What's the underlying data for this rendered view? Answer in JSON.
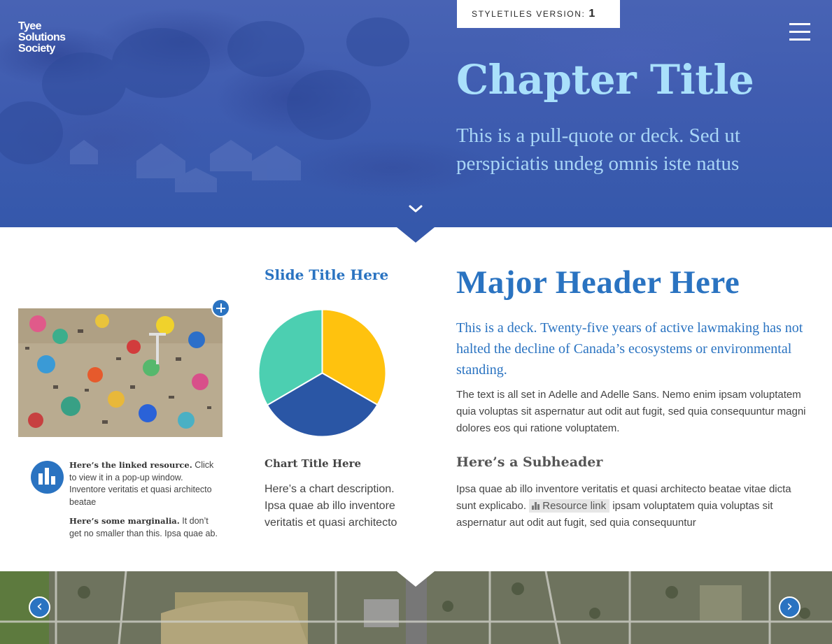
{
  "header": {
    "logo_lines": [
      "Tyee",
      "Solutions",
      "Society"
    ],
    "version_label": "STYLETILES VERSION: ",
    "version_number": "1",
    "chapter_title": "Chapter Title",
    "chapter_deck": "This is a pull-quote or deck. Sed ut perspiciatis undeg omnis iste natus",
    "icons": {
      "menu": "hamburger-menu-icon",
      "scroll": "chevron-down-icon"
    }
  },
  "left_column": {
    "marginalia": [
      {
        "bold": "Here’s the linked resource.",
        "text": " Click to view it in a pop-up window. Inventore veritatis et quasi architecto beatae"
      },
      {
        "bold": "Here’s some marginalia.",
        "text": " It don’t get no smaller than this. Ipsa quae ab."
      }
    ]
  },
  "middle_column": {
    "slide_title": "Slide Title Here",
    "chart_title": "Chart Title Here",
    "chart_description": "Here’s a chart description. Ipsa quae ab illo inventore veritatis et quasi architecto"
  },
  "chart_data": {
    "type": "pie",
    "title": "",
    "slices": [
      {
        "value": 33.3,
        "color": "#ffc20e"
      },
      {
        "value": 33.3,
        "color": "#2a56a5"
      },
      {
        "value": 33.4,
        "color": "#4ccfb1"
      }
    ]
  },
  "right_column": {
    "major_header": "Major Header Here",
    "deck": "This is a deck. Twenty-five years of active lawmaking has not halted the decline of Canada’s ecosystems or environmental standing.",
    "body": "The text is all set in Adelle and Adelle Sans. Nemo enim ipsam voluptatem quia voluptas sit aspernatur aut odit aut fugit, sed quia consequuntur magni dolores eos qui ratione voluptatem.",
    "subheader": "Here’s a Subheader",
    "body2_before": "Ipsa quae ab illo inventore veritatis et quasi architecto beatae vitae dicta sunt explicabo. ",
    "resource_link": "Resource link",
    "body2_after": " ipsam voluptatem quia voluptas sit aspernatur aut odit aut fugit, sed quia consequuntur"
  },
  "carousel": {
    "prev_glyph": "‹",
    "next_glyph": "›"
  },
  "colors": {
    "accent_blue": "#2a73c1",
    "hero_blue": "#3558ab",
    "title_light_blue": "#a9e0fb"
  }
}
